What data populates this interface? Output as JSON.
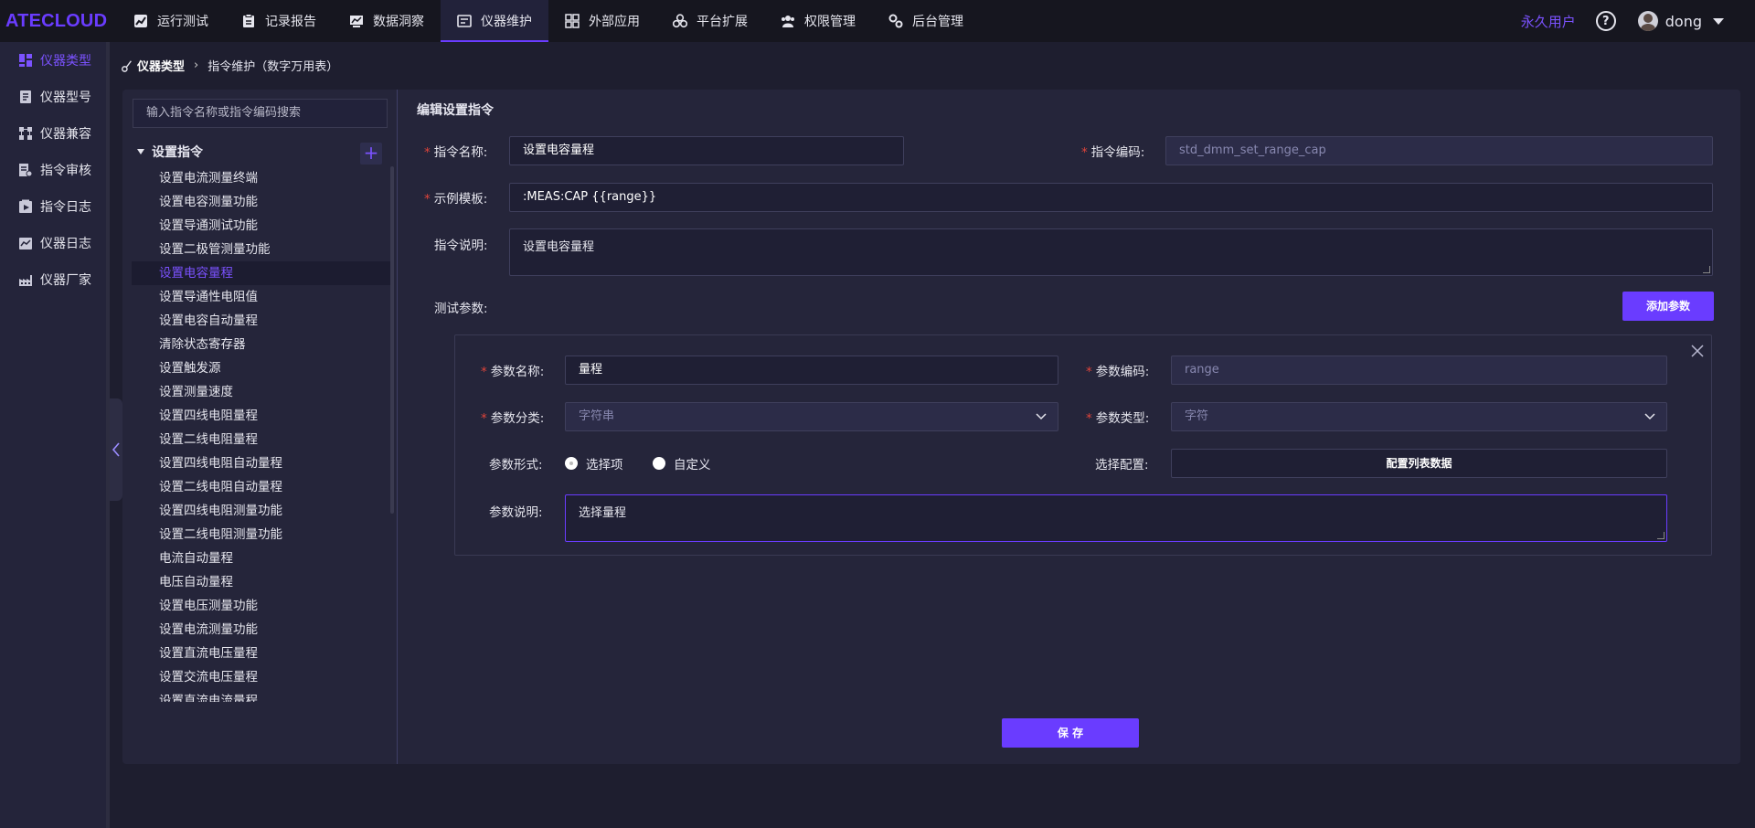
{
  "app": {
    "logo": "ATECLOUD"
  },
  "nav": [
    {
      "label": "运行测试",
      "icon": "chart-line-icon"
    },
    {
      "label": "记录报告",
      "icon": "clipboard-icon"
    },
    {
      "label": "数据洞察",
      "icon": "monitor-chart-icon"
    },
    {
      "label": "仪器维护",
      "icon": "instrument-icon",
      "active": true
    },
    {
      "label": "外部应用",
      "icon": "grid-icon"
    },
    {
      "label": "平台扩展",
      "icon": "cubes-icon"
    },
    {
      "label": "权限管理",
      "icon": "shield-users-icon"
    },
    {
      "label": "后台管理",
      "icon": "gears-icon"
    }
  ],
  "user": {
    "tier": "永久用户",
    "help": "?",
    "name": "dong"
  },
  "sidebar": [
    {
      "label": "仪器类型",
      "icon": "dashboard-icon",
      "active": true
    },
    {
      "label": "仪器型号",
      "icon": "model-icon"
    },
    {
      "label": "仪器兼容",
      "icon": "network-icon"
    },
    {
      "label": "指令审核",
      "icon": "audit-icon"
    },
    {
      "label": "指令日志",
      "icon": "play-log-icon"
    },
    {
      "label": "仪器日志",
      "icon": "instrument-log-icon"
    },
    {
      "label": "仪器厂家",
      "icon": "factory-icon"
    }
  ],
  "breadcrumb": {
    "root": "仪器类型",
    "current": "指令维护（数字万用表）"
  },
  "tree": {
    "search_placeholder": "输入指令名称或指令编码搜索",
    "group": "设置指令",
    "add": "+",
    "items": [
      "设置电流测量终端",
      "设置电容测量功能",
      "设置导通测试功能",
      "设置二极管测量功能",
      "设置电容量程",
      "设置导通性电阻值",
      "设置电容自动量程",
      "清除状态寄存器",
      "设置触发源",
      "设置测量速度",
      "设置四线电阻量程",
      "设置二线电阻量程",
      "设置四线电阻自动量程",
      "设置二线电阻自动量程",
      "设置四线电阻测量功能",
      "设置二线电阻测量功能",
      "电流自动量程",
      "电压自动量程",
      "设置电压测量功能",
      "设置电流测量功能",
      "设置直流电压量程",
      "设置交流电压量程",
      "设置直流电流量程"
    ],
    "active_index": 4
  },
  "form": {
    "title": "编辑设置指令",
    "name_label": "指令名称:",
    "name_value": "设置电容量程",
    "code_label": "指令编码:",
    "code_value": "std_dmm_set_range_cap",
    "template_label": "示例模板:",
    "template_value": ":MEAS:CAP {{range}}",
    "desc_label": "指令说明:",
    "desc_value": "设置电容量程",
    "params_label": "测试参数:",
    "add_param": "添加参数",
    "save": "保 存"
  },
  "param": {
    "name_label": "参数名称:",
    "name_value": "量程",
    "code_label": "参数编码:",
    "code_value": "range",
    "category_label": "参数分类:",
    "category_value": "字符串",
    "type_label": "参数类型:",
    "type_value": "字符",
    "form_label": "参数形式:",
    "option_select": "选择项",
    "option_custom": "自定义",
    "config_label": "选择配置:",
    "config_button": "配置列表数据",
    "desc_label": "参数说明:",
    "desc_value": "选择量程"
  },
  "colors": {
    "accent": "#6a3cff",
    "background": "#1e1e2f",
    "panel": "#25253a",
    "required": "#e0443a"
  }
}
